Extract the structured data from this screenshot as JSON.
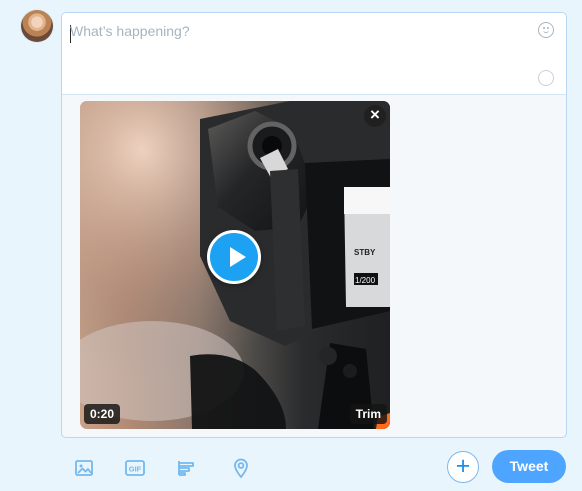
{
  "composer": {
    "placeholder": "What’s happening?"
  },
  "media": {
    "duration": "0:20",
    "trim_label": "Trim"
  },
  "actions": {
    "tweet_label": "Tweet"
  },
  "icons": {
    "media": "image-icon",
    "gif": "gif-icon",
    "poll": "poll-icon",
    "location": "location-icon",
    "add": "plus-icon",
    "emoji": "emoji-icon",
    "counter": "character-counter-icon",
    "close": "close-icon",
    "play": "play-icon"
  },
  "colors": {
    "accent": "#1da1f2",
    "tweet_button": "#4ea5ff",
    "page_background": "#e8f5fd"
  }
}
